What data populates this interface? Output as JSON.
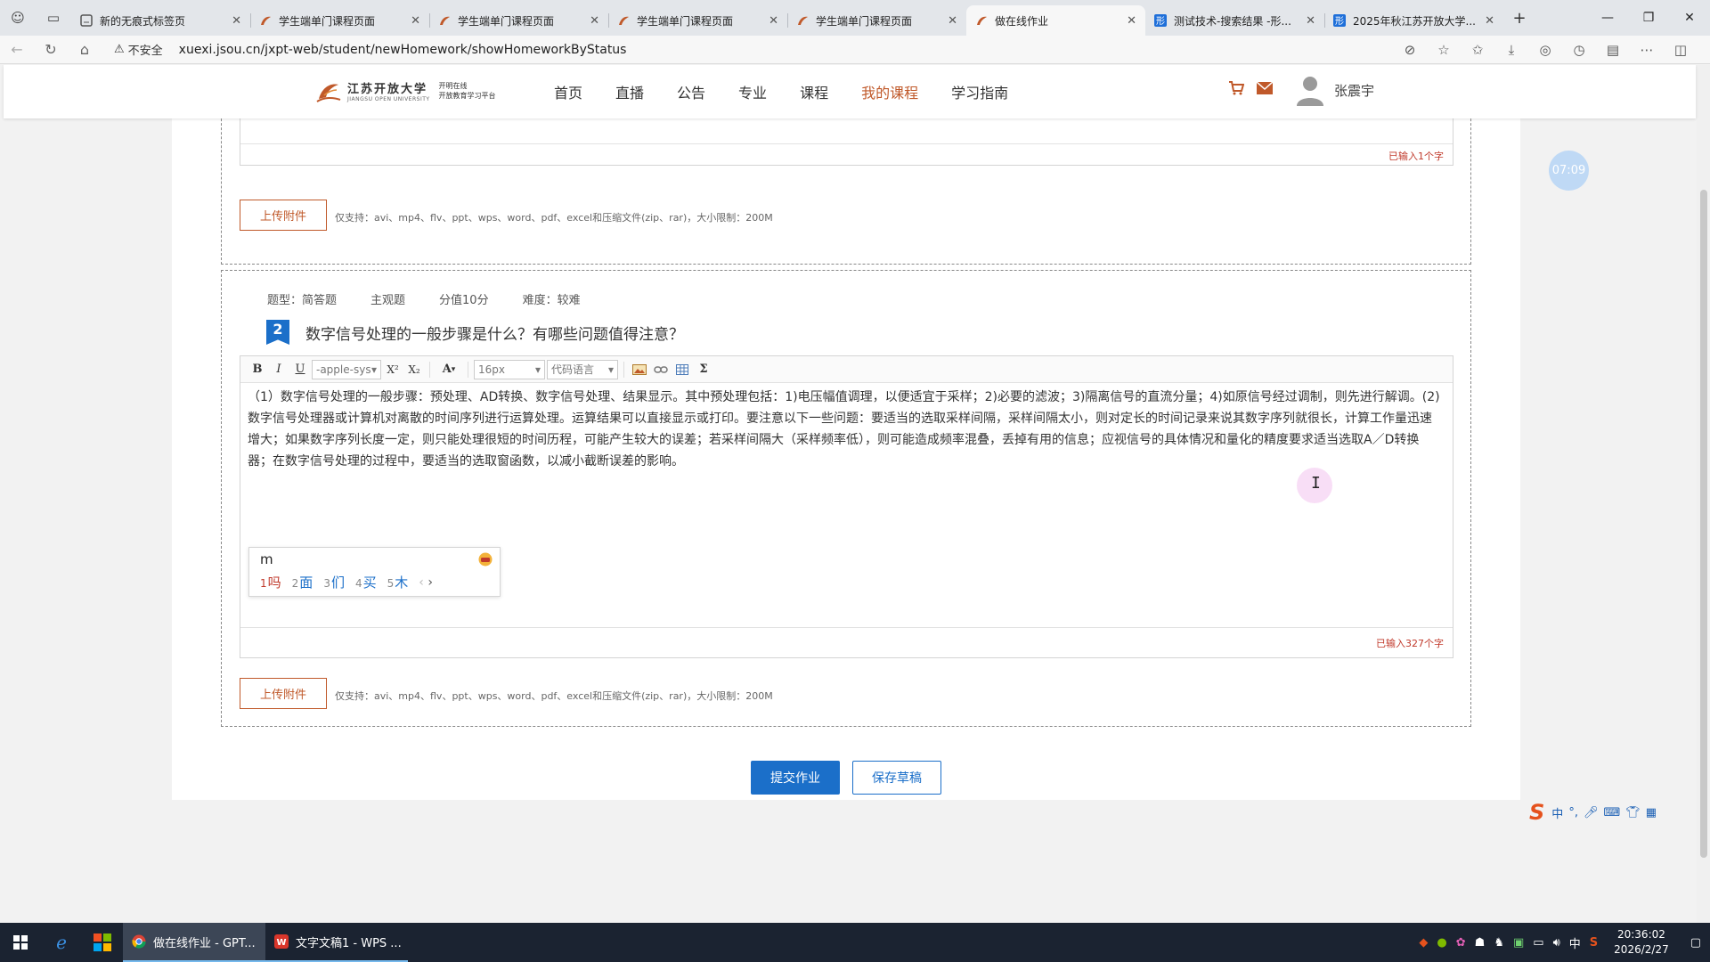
{
  "browser": {
    "tabs": [
      {
        "title": "新的无痕式标签页",
        "active": false,
        "icon": "incognito-icon"
      },
      {
        "title": "学生端单门课程页面",
        "active": false,
        "icon": "site-favicon"
      },
      {
        "title": "学生端单门课程页面",
        "active": false,
        "icon": "site-favicon"
      },
      {
        "title": "学生端单门课程页面",
        "active": false,
        "icon": "site-favicon"
      },
      {
        "title": "学生端单门课程页面",
        "active": false,
        "icon": "site-favicon"
      },
      {
        "title": "做在线作业",
        "active": true,
        "icon": "site-favicon"
      },
      {
        "title": "测试技术-搜索结果 -形...",
        "active": false,
        "icon": "search-favicon"
      },
      {
        "title": "2025年秋江苏开放大学...",
        "active": false,
        "icon": "search-favicon"
      }
    ],
    "insecure_label": "不安全",
    "url": "xuexi.jsou.cn/jxpt-web/student/newHomework/showHomeworkByStatus"
  },
  "site": {
    "logo_cn": "江苏开放大学",
    "logo_en": "JIANGSU OPEN UNIVERSITY",
    "logo_sub1": "开明在线",
    "logo_sub2": "开放教育学习平台",
    "nav": [
      {
        "label": "首页",
        "current": false
      },
      {
        "label": "直播",
        "current": false
      },
      {
        "label": "公告",
        "current": false
      },
      {
        "label": "专业",
        "current": false
      },
      {
        "label": "课程",
        "current": false
      },
      {
        "label": "我的课程",
        "current": true
      },
      {
        "label": "学习指南",
        "current": false
      }
    ],
    "user_name": "张震宇"
  },
  "question1": {
    "counter": "已输入1个字",
    "upload_label": "上传附件",
    "upload_hint": "仅支持：avi、mp4、flv、ppt、wps、word、pdf、excel和压缩文件(zip、rar)，大小限制：200M"
  },
  "question2": {
    "meta": {
      "type": "题型：简答题",
      "subjective": "主观题",
      "score": "分值10分",
      "difficulty": "难度：较难"
    },
    "number": "2",
    "title": "数字信号处理的一般步骤是什么？有哪些问题值得注意？",
    "toolbar": {
      "bold": "B",
      "italic": "I",
      "underline": "U",
      "font_family": "-apple-sys",
      "superscript": "X²",
      "subscript": "X₂",
      "font_color": "A",
      "font_size": "16px",
      "code_language": "代码语言",
      "sigma": "Σ"
    },
    "answer": "（1）数字信号处理的一般步骤：预处理、AD转换、数字信号处理、结果显示。其中预处理包括：1)电压幅值调理，以便适宜于采样；2)必要的滤波；3)隔离信号的直流分量；4)如原信号经过调制，则先进行解调。(2)数字信号处理器或计算机对离散的时间序列进行运算处理。运算结果可以直接显示或打印。要注意以下一些问题：要适当的选取采样间隔，采样间隔太小，则对定长的时间记录来说其数字序列就很长，计算工作量迅速增大；如果数字序列长度一定，则只能处理很短的时间历程，可能产生较大的误差；若采样间隔大（采样频率低），则可能造成频率混叠，丢掉有用的信息；应视信号的具体情况和量化的精度要求适当选取A／D转换器；在数字信号处理的过程中，要适当的选取窗函数，以减小截断误差的影响。",
    "counter": "已输入327个字",
    "upload_label": "上传附件",
    "upload_hint": "仅支持：avi、mp4、flv、ppt、wps、word、pdf、excel和压缩文件(zip、rar)，大小限制：200M"
  },
  "ime": {
    "input": "m",
    "candidates": [
      {
        "index": "1",
        "text": "吗"
      },
      {
        "index": "2",
        "text": "面"
      },
      {
        "index": "3",
        "text": "们"
      },
      {
        "index": "4",
        "text": "买"
      },
      {
        "index": "5",
        "text": "木"
      }
    ]
  },
  "actions": {
    "submit": "提交作业",
    "save_draft": "保存草稿"
  },
  "timer": "07:09",
  "sogou_toolbar": {
    "mode": "中",
    "punct": "°,"
  },
  "taskbar": {
    "apps": [
      {
        "label": "做在线作业 - GPT...",
        "active": true
      },
      {
        "label": "文字文稿1 - WPS ...",
        "active": false
      }
    ],
    "ime_lang": "中",
    "time": "20:36:02",
    "date": "2026/2/27"
  },
  "colors": {
    "accent_blue": "#1b6fc9",
    "accent_orange": "#c0592a",
    "counter_red": "#c0392b"
  }
}
